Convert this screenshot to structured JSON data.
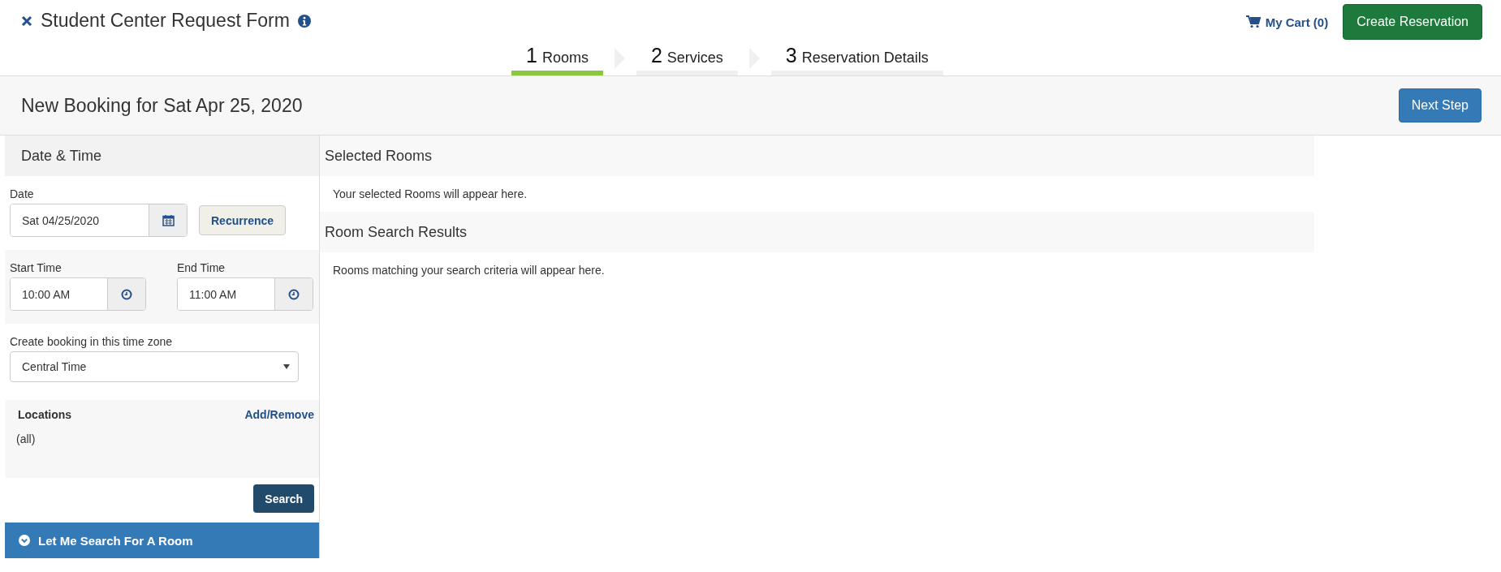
{
  "header": {
    "title": "Student Center Request Form",
    "cart": "My Cart (0)",
    "create_button": "Create Reservation"
  },
  "steps": [
    {
      "number": "1",
      "label": "Rooms",
      "selected": true
    },
    {
      "number": "2",
      "label": "Services",
      "selected": false
    },
    {
      "number": "3",
      "label": "Reservation Details",
      "selected": false
    }
  ],
  "booking_bar": {
    "title": "New Booking for Sat Apr 25, 2020",
    "next_button": "Next Step"
  },
  "sidebar": {
    "heading": "Date & Time",
    "date": {
      "label": "Date",
      "value": "Sat 04/25/2020"
    },
    "recurrence_button": "Recurrence",
    "start_time": {
      "label": "Start Time",
      "value": "10:00 AM"
    },
    "end_time": {
      "label": "End Time",
      "value": "11:00 AM"
    },
    "time_zone": {
      "label": "Create booking in this time zone",
      "value": "Central Time"
    },
    "locations": {
      "label": "Locations",
      "link": "Add/Remove",
      "value": "(all)"
    },
    "search_button": "Search",
    "search_toggle": "Let Me Search For A Room"
  },
  "sections": [
    {
      "heading": "Selected Rooms",
      "message": "Your selected Rooms will appear here."
    },
    {
      "heading": "Room Search Results",
      "message": "Rooms matching your search criteria will appear here."
    }
  ]
}
